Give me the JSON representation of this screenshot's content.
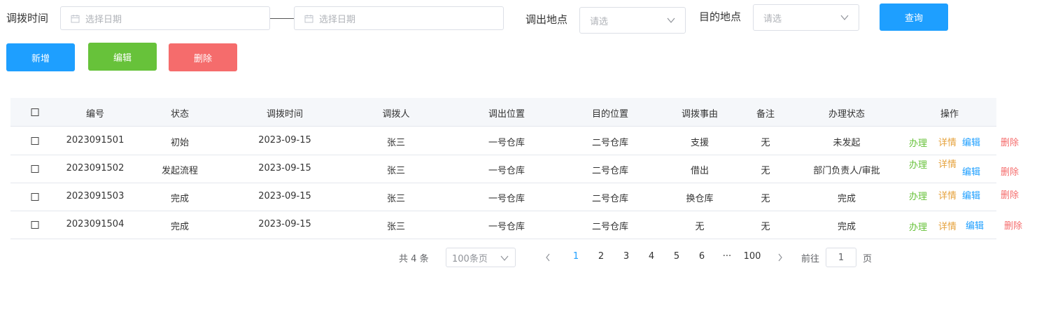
{
  "filters": {
    "time_label": "调拨时间",
    "start_placeholder": "选择日期",
    "end_placeholder": "选择日期",
    "from_label": "调出地点",
    "from_placeholder": "请选",
    "to_label": "目的地点",
    "to_placeholder": "请选",
    "query_label": "查询"
  },
  "actions": {
    "add_label": "新增",
    "edit_label": "编辑",
    "delete_label": "删除"
  },
  "colors": {
    "primary": "#1e9fff",
    "success": "#67c23a",
    "danger": "#f56c6c",
    "warning": "#e6a23c"
  },
  "table": {
    "headers": [
      "编号",
      "状态",
      "调拨时间",
      "调拨人",
      "调出位置",
      "目的位置",
      "调拨事由",
      "备注",
      "办理状态",
      "操作"
    ],
    "rows": [
      {
        "id": "2023091501",
        "status": "初始",
        "time": "2023-09-15",
        "person": "张三",
        "from": "一号仓库",
        "to": "二号仓库",
        "reason": "支援",
        "note": "无",
        "handle": "未发起"
      },
      {
        "id": "2023091502",
        "status": "发起流程",
        "time": "2023-09-15",
        "person": "张三",
        "from": "一号仓库",
        "to": "二号仓库",
        "reason": "借出",
        "note": "无",
        "handle": "部门负责人/审批"
      },
      {
        "id": "2023091503",
        "status": "完成",
        "time": "2023-09-15",
        "person": "张三",
        "from": "一号仓库",
        "to": "二号仓库",
        "reason": "换仓库",
        "note": "无",
        "handle": "完成"
      },
      {
        "id": "2023091504",
        "status": "完成",
        "time": "2023-09-15",
        "person": "张三",
        "from": "一号仓库",
        "to": "二号仓库",
        "reason": "无",
        "note": "无",
        "handle": "完成"
      }
    ],
    "ops": {
      "handle": "办理",
      "detail": "详情",
      "edit": "编辑",
      "delete": "删除"
    }
  },
  "pagination": {
    "total_prefix": "共",
    "total": "4",
    "total_suffix": "条",
    "page_size": "100条页",
    "pages": [
      "1",
      "2",
      "3",
      "4",
      "5",
      "6",
      "···",
      "100"
    ],
    "current_page": "1",
    "goto_prefix": "前往",
    "goto_value": "1",
    "goto_suffix": "页"
  }
}
